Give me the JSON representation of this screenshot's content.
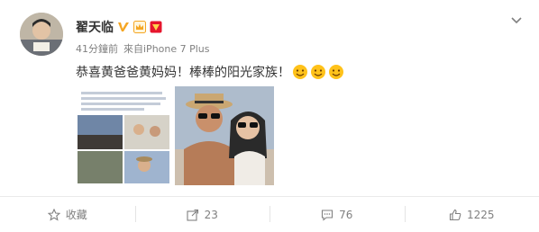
{
  "post": {
    "username": "翟天临",
    "time": "41分鐘前",
    "source": "來自iPhone 7 Plus",
    "text": "恭喜黄爸爸黄妈妈！棒棒的阳光家族！"
  },
  "actions": {
    "favorite_label": "收藏",
    "repost_count": "23",
    "comment_count": "76",
    "like_count": "1225"
  },
  "icons": {
    "verified": "verified-v-icon",
    "vip": "vip-crown-icon",
    "red": "red-badge-icon",
    "menu": "chevron-down-icon",
    "emoji": "sun-emoji-icon",
    "favorite": "star-icon",
    "repost": "repost-icon",
    "comment": "comment-icon",
    "like": "thumbs-up-icon"
  },
  "colors": {
    "verified": "#f5a623",
    "brand_red": "#e6162d",
    "muted": "#808080"
  }
}
